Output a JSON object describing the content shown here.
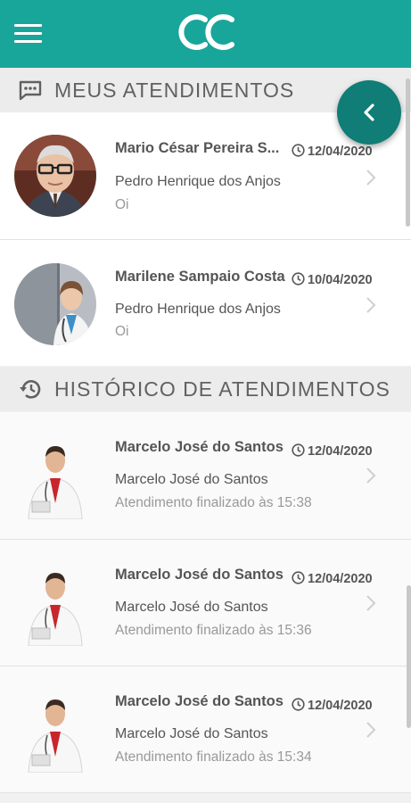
{
  "header": {
    "menu_icon": "hamburger-menu-icon",
    "logo": "OC"
  },
  "sections": {
    "current": {
      "title": "MEUS ATENDIMENTOS",
      "icon": "chat-bubble-icon"
    },
    "history": {
      "title": "HISTÓRICO DE ATENDIMENTOS",
      "icon": "history-icon"
    }
  },
  "fab": {
    "icon": "chevron-left-icon"
  },
  "current_items": [
    {
      "name": "Mario César Pereira S...",
      "date": "12/04/2020",
      "subtitle": "Pedro Henrique dos Anjos",
      "message": "Oi"
    },
    {
      "name": "Marilene Sampaio Costa",
      "date": "10/04/2020",
      "subtitle": "Pedro Henrique dos Anjos",
      "message": "Oi"
    }
  ],
  "history_items": [
    {
      "name": "Marcelo José do Santos",
      "date": "12/04/2020",
      "subtitle": "Marcelo José do Santos",
      "message": "Atendimento finalizado às 15:38"
    },
    {
      "name": "Marcelo José do Santos",
      "date": "12/04/2020",
      "subtitle": "Marcelo José do Santos",
      "message": "Atendimento finalizado às 15:36"
    },
    {
      "name": "Marcelo José do Santos",
      "date": "12/04/2020",
      "subtitle": "Marcelo José do Santos",
      "message": "Atendimento finalizado às 15:34"
    }
  ],
  "colors": {
    "primary": "#19a69a",
    "fab": "#107d76",
    "text": "#555555",
    "muted": "#999999"
  }
}
